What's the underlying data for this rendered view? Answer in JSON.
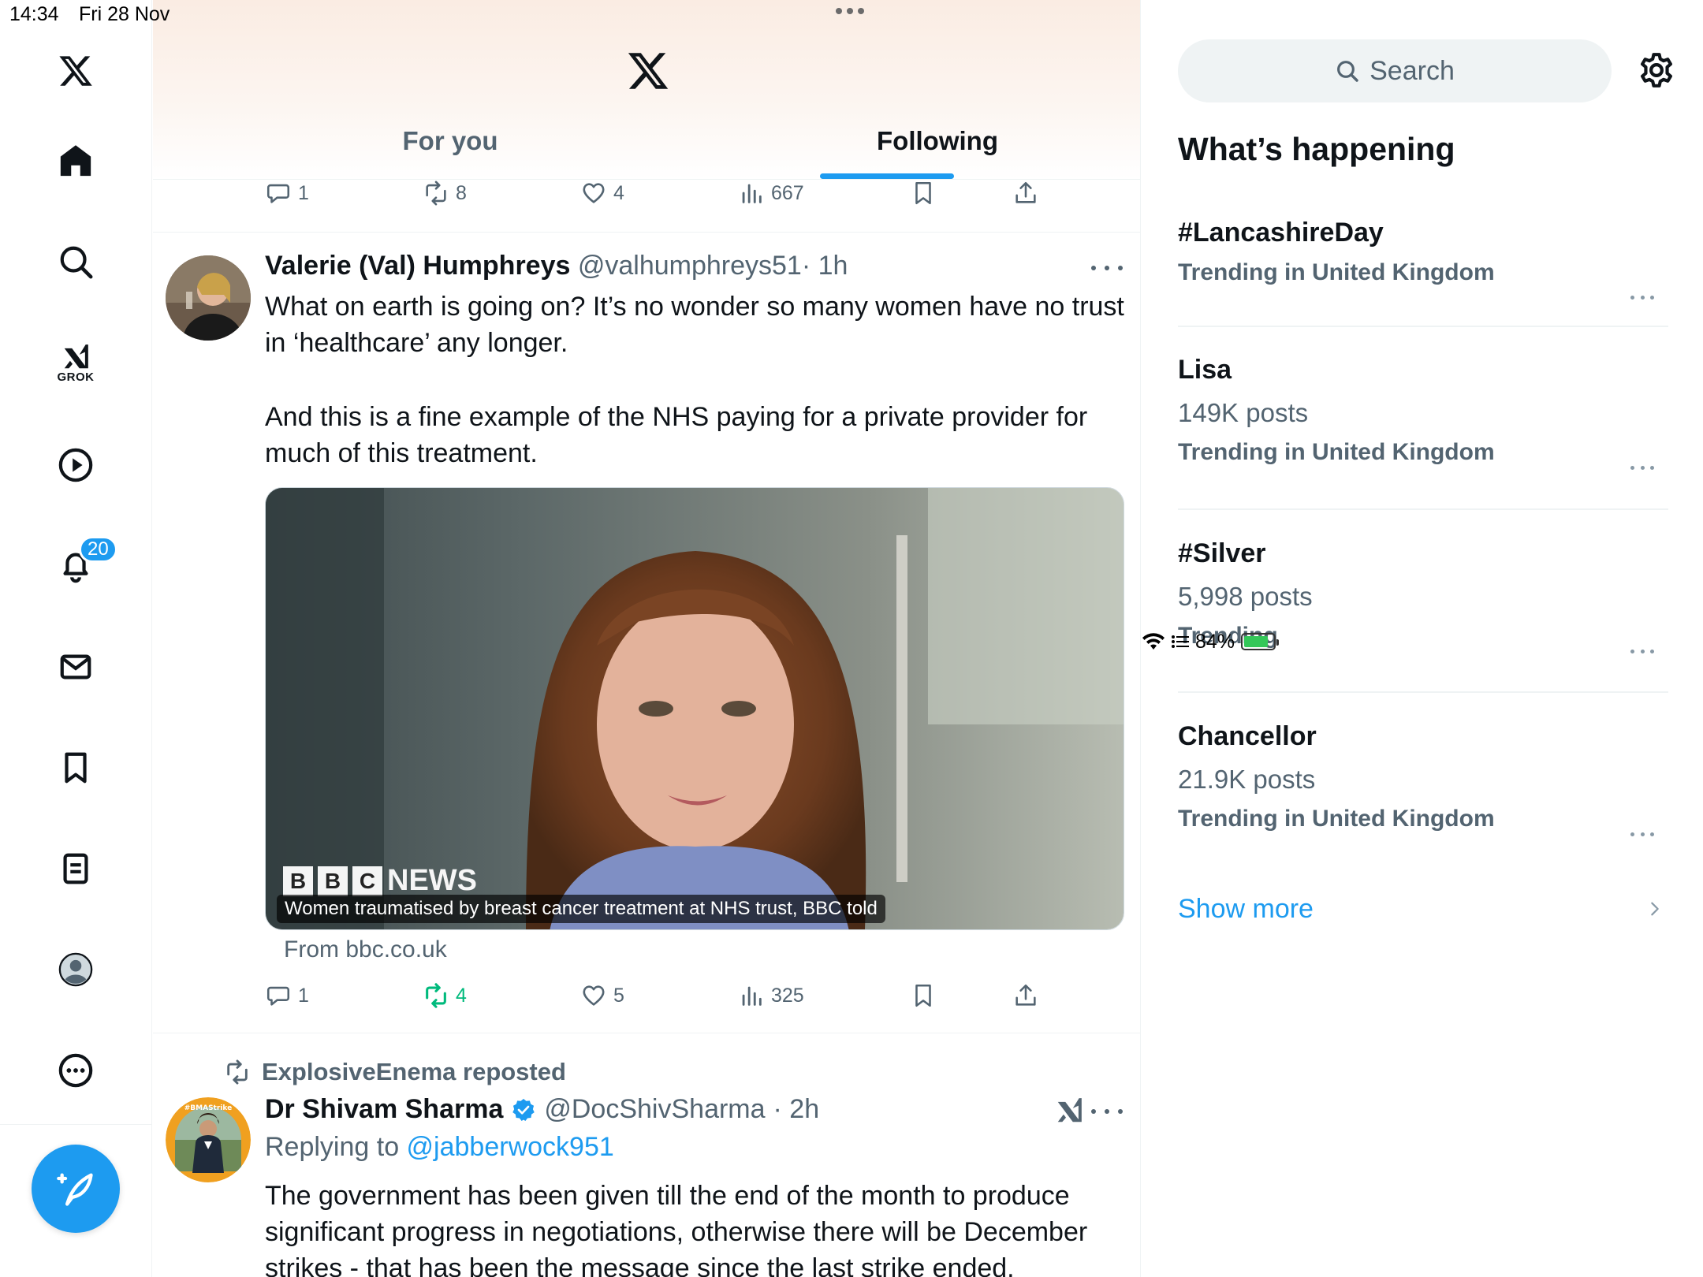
{
  "status_bar": {
    "time": "14:34",
    "date": "Fri 28 Nov",
    "battery": "84%",
    "battery_level": 0.84
  },
  "nav": {
    "notification_count": "20",
    "grok_label": "GROK"
  },
  "header": {
    "tabs": [
      {
        "label": "For you",
        "active": false
      },
      {
        "label": "Following",
        "active": true
      }
    ]
  },
  "prev_post": {
    "replies": "1",
    "reposts": "8",
    "likes": "4",
    "views": "667"
  },
  "post1": {
    "name": "Valerie (Val) Humphreys",
    "handle": "@valhumphreys51",
    "time": "· 1h",
    "paragraph1": "What on earth is going on? It’s no wonder so many women have no trust in ‘healthcare’ any longer.",
    "paragraph2": "And this is a fine example of the NHS paying for a private provider for much of this treatment.",
    "media_caption": "Women traumatised by breast cancer treatment at NHS trust, BBC told",
    "media_logo": [
      "B",
      "B",
      "C",
      "NEWS"
    ],
    "from": "From bbc.co.uk",
    "replies": "1",
    "reposts": "4",
    "likes": "5",
    "views": "325"
  },
  "post2": {
    "repost_by": "ExplosiveEnema reposted",
    "name": "Dr Shivam Sharma",
    "handle": "@DocShivSharma",
    "time": "· 2h",
    "replying_prefix": "Replying to ",
    "replying_to": "@jabberwock951",
    "text": "The government has been given till the end of the month to produce significant progress in negotiations, otherwise there will be December strikes - that has been the message since the last strike ended.",
    "avatar_ring_text": "#BMAStrike"
  },
  "sidebar": {
    "search_placeholder": "Search",
    "section_title": "What’s happening",
    "trends": [
      {
        "name": "#LancashireDay",
        "count": "",
        "location": "Trending in United Kingdom"
      },
      {
        "name": "Lisa",
        "count": "149K posts",
        "location": "Trending in United Kingdom"
      },
      {
        "name": "#Silver",
        "count": "5,998 posts",
        "location": "Trending"
      },
      {
        "name": "Chancellor",
        "count": "21.9K posts",
        "location": "Trending in United Kingdom"
      }
    ],
    "show_more": "Show more"
  },
  "colors": {
    "accent": "#1d9bf0",
    "repost_green": "#00ba7c",
    "secondary_text": "#536471"
  }
}
